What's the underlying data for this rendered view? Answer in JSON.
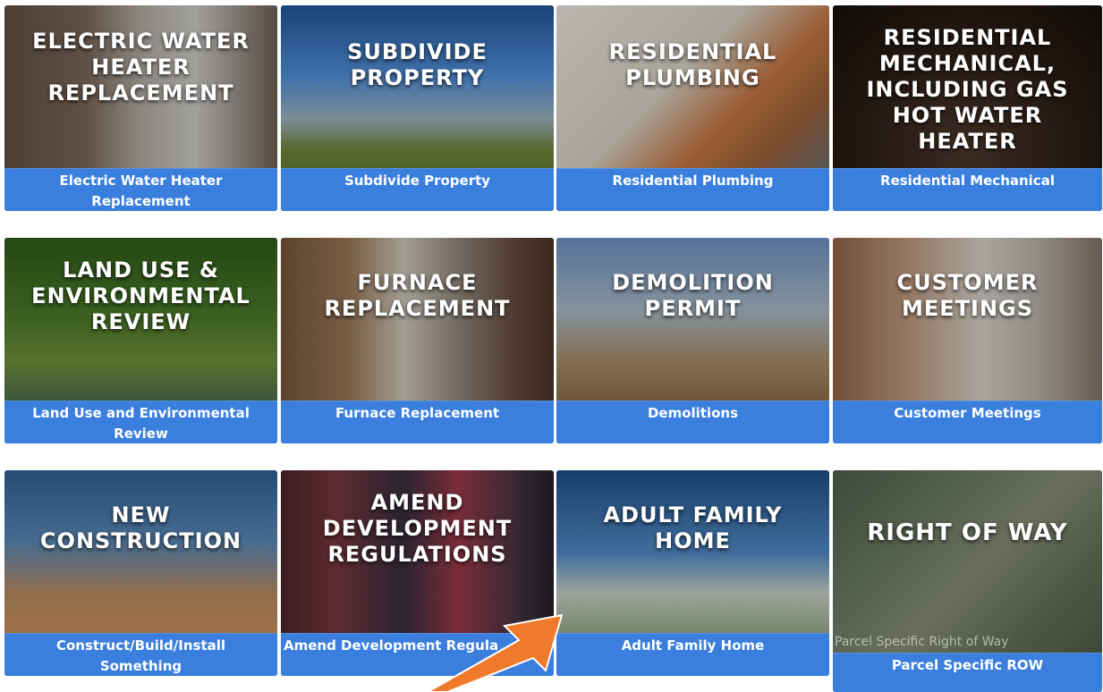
{
  "tiles": [
    {
      "heading": "ELECTRIC WATER\nHEATER\nREPLACEMENT",
      "label": "Electric Water Heater\nReplacement"
    },
    {
      "heading": "SUBDIVIDE\nPROPERTY",
      "label": "Subdivide Property"
    },
    {
      "heading": "RESIDENTIAL\nPLUMBING",
      "label": "Residential Plumbing"
    },
    {
      "heading": "RESIDENTIAL\nMECHANICAL,\nINCLUDING GAS\nHOT WATER HEATER",
      "label": "Residential Mechanical"
    },
    {
      "heading": "LAND USE &\nENVIRONMENTAL\nREVIEW",
      "label": "Land Use and Environmental\nReview"
    },
    {
      "heading": "FURNACE\nREPLACEMENT",
      "label": "Furnace Replacement"
    },
    {
      "heading": "DEMOLITION\nPERMIT",
      "label": "Demolitions"
    },
    {
      "heading": "CUSTOMER\nMEETINGS",
      "label": "Customer Meetings"
    },
    {
      "heading": "NEW\nCONSTRUCTION",
      "label": "Construct/Build/Install\nSomething"
    },
    {
      "heading": "AMEND\nDEVELOPMENT\nREGULATIONS",
      "label": "Amend Development Regula"
    },
    {
      "heading": "ADULT FAMILY\nHOME",
      "label": "Adult Family Home"
    },
    {
      "heading": "RIGHT OF WAY",
      "caption": "Parcel Specific Right of Way",
      "label": "Parcel Specific ROW"
    }
  ],
  "colors": {
    "band": "#3a7fde",
    "arrow": "#f07a2c"
  }
}
